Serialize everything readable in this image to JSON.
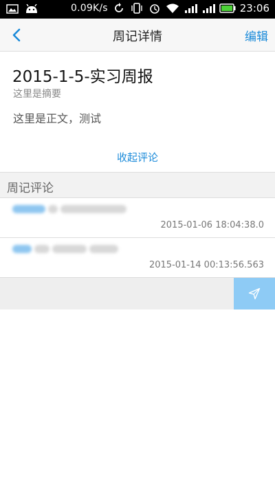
{
  "status_bar": {
    "network_speed": "0.09K/s",
    "time": "23:06",
    "icons": [
      "image-icon",
      "android-icon",
      "sync-icon",
      "vibrate-icon",
      "alarm-icon",
      "wifi-icon",
      "signal-icon",
      "signal-icon",
      "battery-icon"
    ]
  },
  "navbar": {
    "back_icon": "chevron-left-icon",
    "title": "周记详情",
    "edit_label": "编辑"
  },
  "journal": {
    "title": "2015-1-5-实习周报",
    "summary": "这里是摘要",
    "body": "这里是正文，测试",
    "collapse_label": "收起评论"
  },
  "comments": {
    "header": "周记评论",
    "items": [
      {
        "time": "2015-01-06 18:04:38.0"
      },
      {
        "time": "2015-01-14 00:13:56.563"
      }
    ]
  },
  "input_bar": {
    "placeholder": "",
    "send_icon": "send-icon"
  },
  "colors": {
    "accent": "#1a8ad9",
    "send_button": "#8ecbf5",
    "divider": "#dcdcdc"
  }
}
